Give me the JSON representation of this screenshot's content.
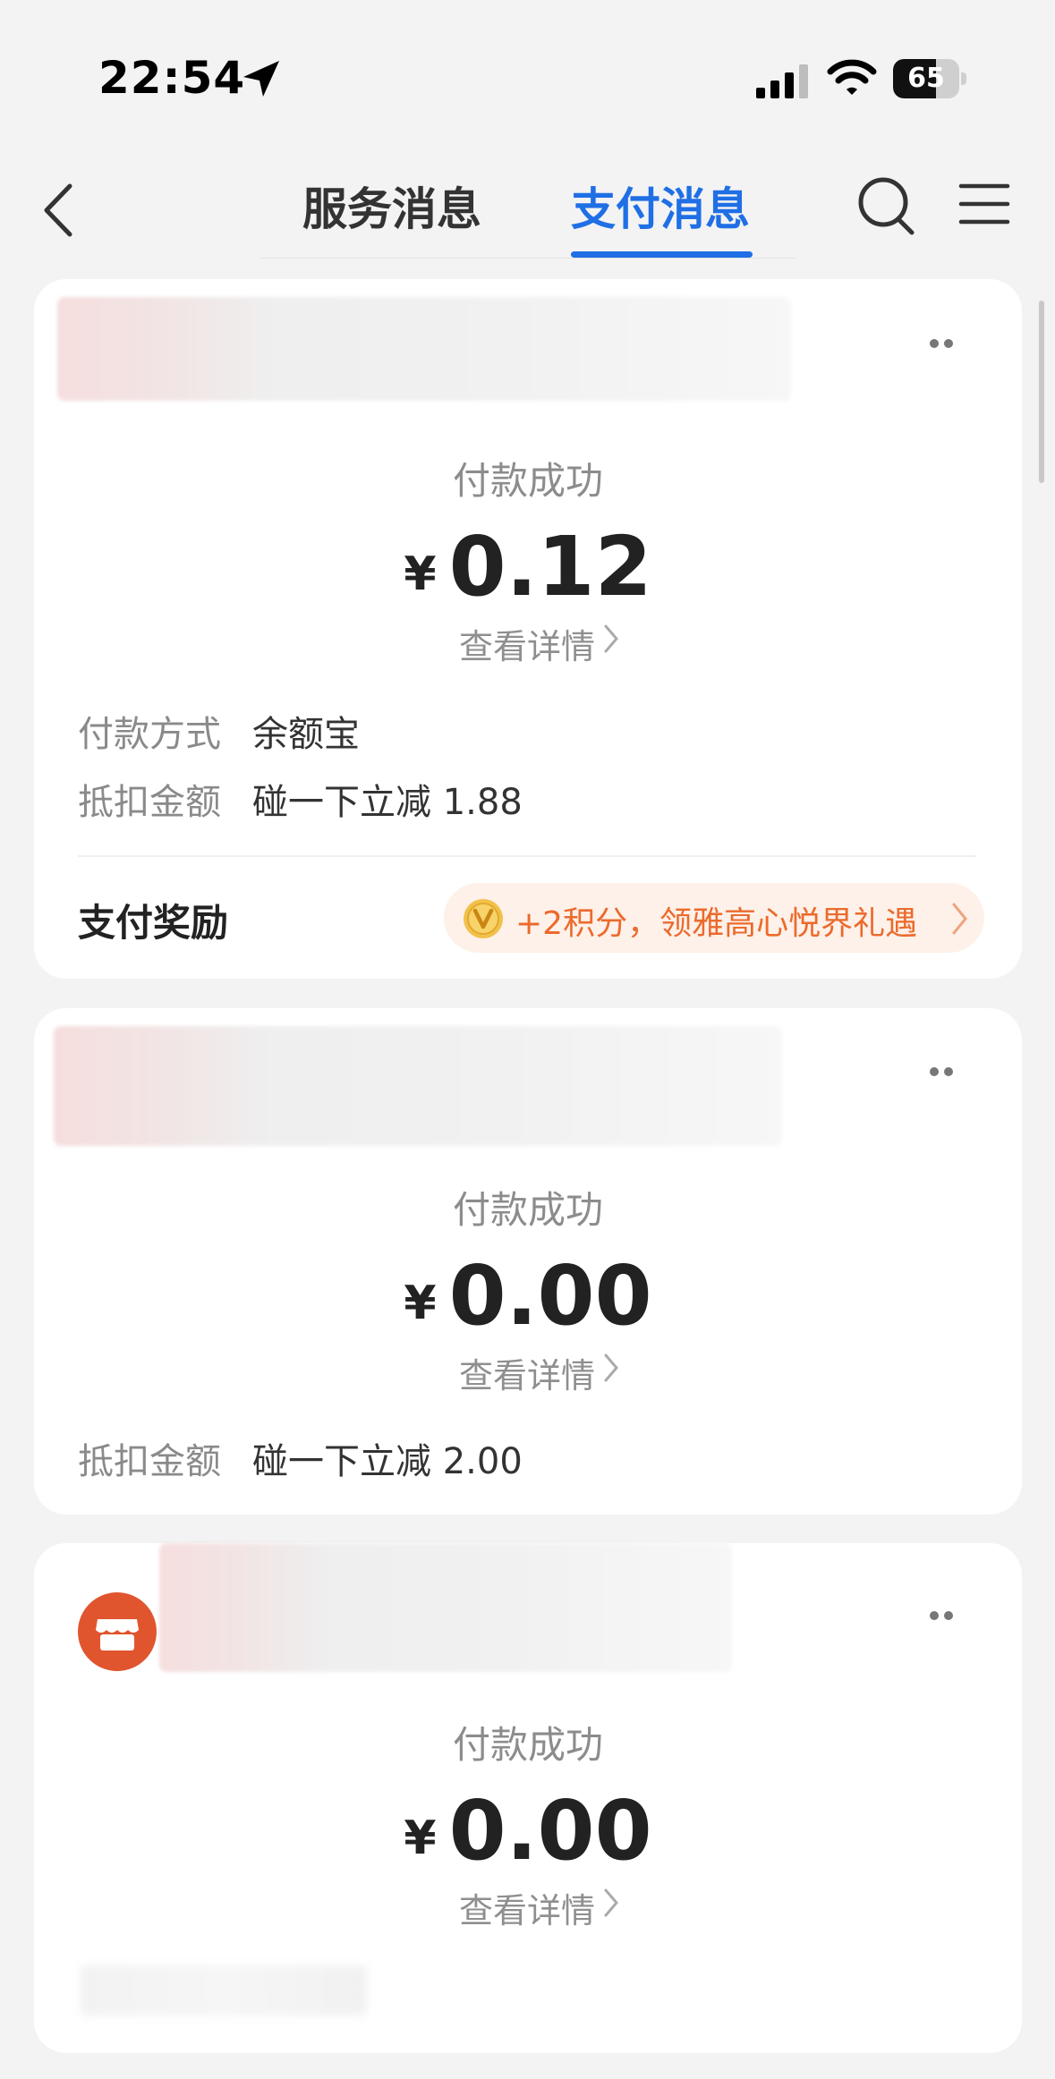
{
  "status_bar": {
    "time": "22:54",
    "battery": "65",
    "battery_level": 0.65
  },
  "nav": {
    "tabs": [
      {
        "label": "服务消息",
        "active": false
      },
      {
        "label": "支付消息",
        "active": true
      }
    ],
    "accent_color": "#1f6fe5"
  },
  "cards": [
    {
      "status": "付款成功",
      "currency": "¥",
      "amount": "0.12",
      "detail_link": "查看详情",
      "rows": [
        {
          "label": "付款方式",
          "value": "余额宝"
        },
        {
          "label": "抵扣金额",
          "value": "碰一下立减 1.88"
        }
      ],
      "reward": {
        "label": "支付奖励",
        "text": "+2积分，领雅高心悦界礼遇",
        "color": "#ec6a2c"
      }
    },
    {
      "status": "付款成功",
      "currency": "¥",
      "amount": "0.00",
      "detail_link": "查看详情",
      "rows": [
        {
          "label": "抵扣金额",
          "value": "碰一下立减 2.00"
        }
      ]
    },
    {
      "icon": "shop-icon",
      "status": "付款成功",
      "currency": "¥",
      "amount": "0.00",
      "detail_link": "查看详情"
    }
  ]
}
